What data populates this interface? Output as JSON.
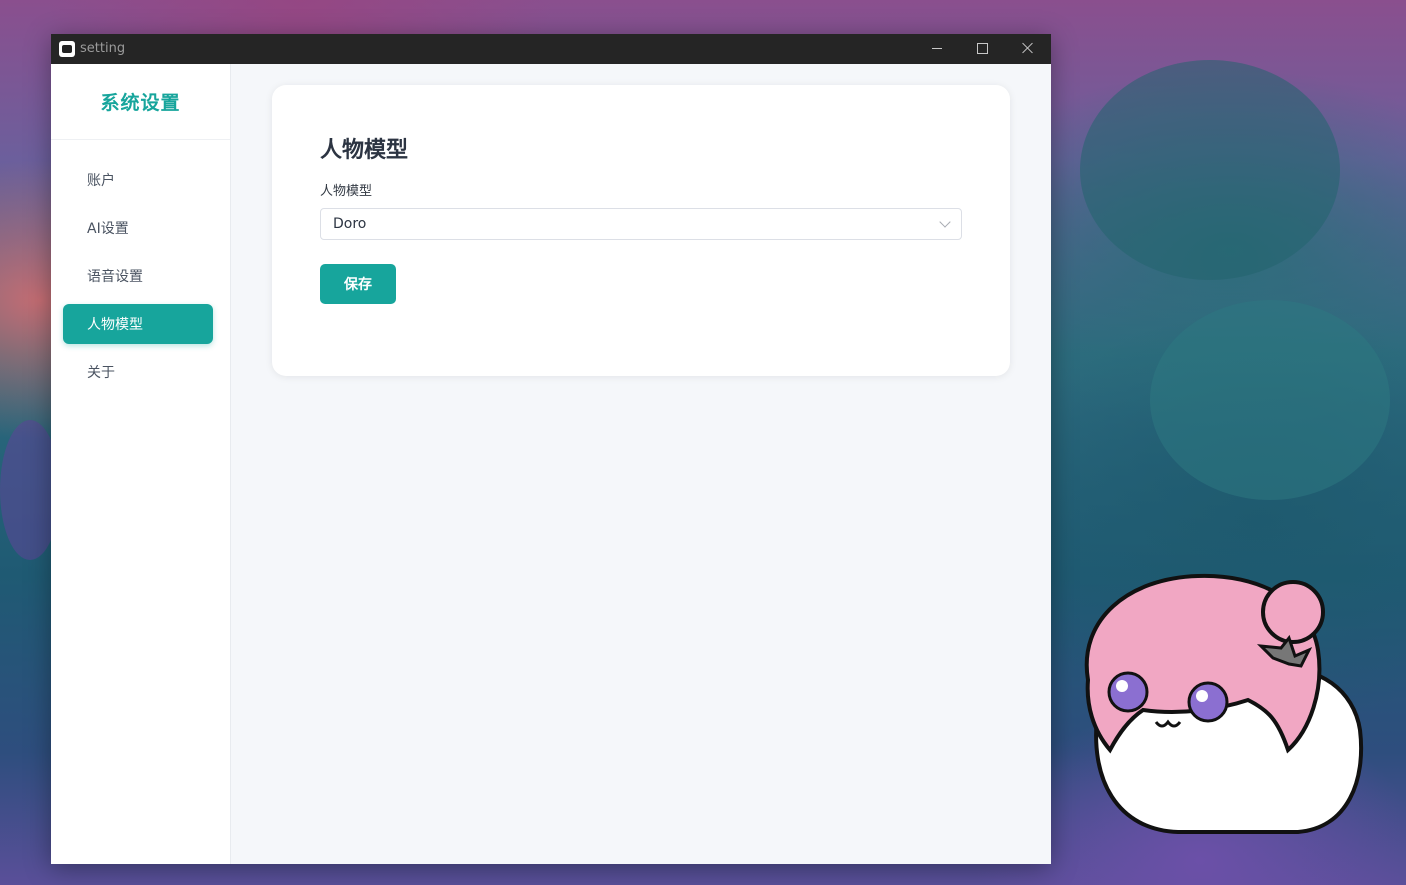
{
  "window": {
    "title": "setting",
    "controls": {
      "minimize_icon": "minimize-icon",
      "maximize_icon": "maximize-icon",
      "close_icon": "close-icon"
    }
  },
  "sidebar": {
    "title": "系统设置",
    "items": [
      {
        "label": "账户",
        "active": false
      },
      {
        "label": "AI设置",
        "active": false
      },
      {
        "label": "语音设置",
        "active": false
      },
      {
        "label": "人物模型",
        "active": true
      },
      {
        "label": "关于",
        "active": false
      }
    ]
  },
  "main": {
    "card": {
      "heading": "人物模型",
      "field_label": "人物模型",
      "select_value": "Doro",
      "save_label": "保存"
    }
  },
  "colors": {
    "accent": "#17a59c",
    "titlebar": "#252525",
    "page_bg": "#f5f7fa"
  }
}
